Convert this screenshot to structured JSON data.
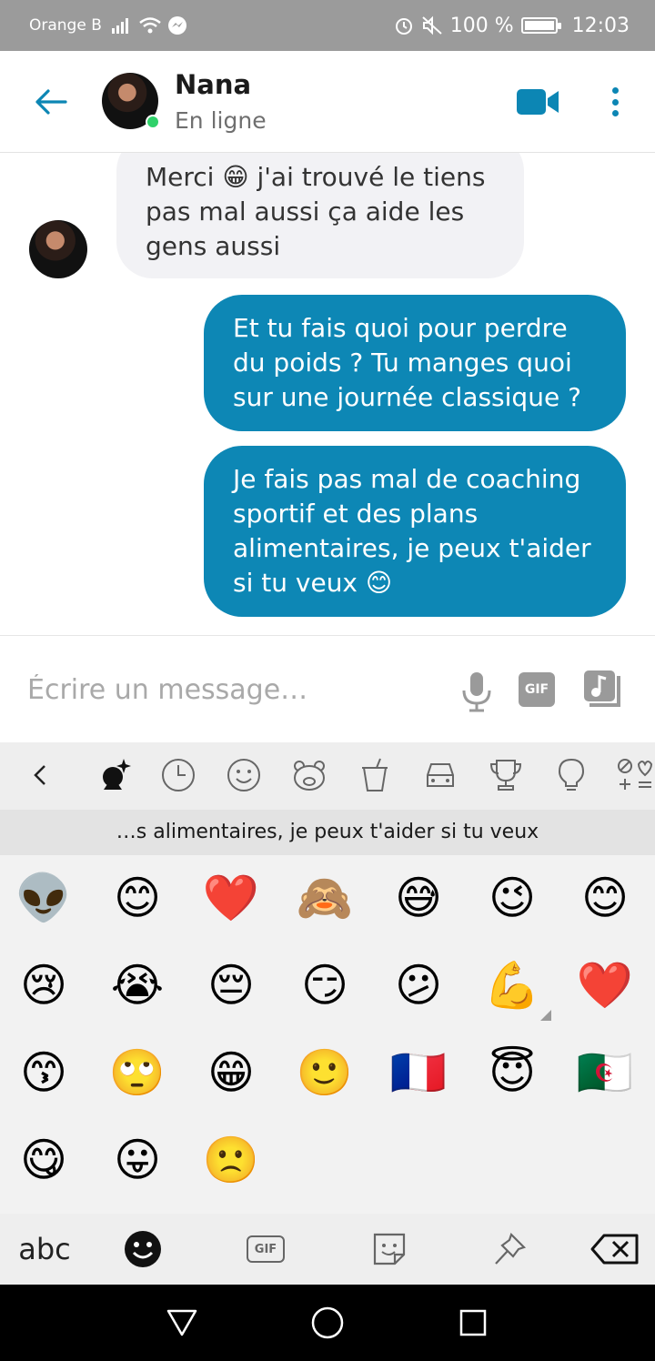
{
  "status_bar": {
    "carrier": "Orange B",
    "battery": "100 %",
    "time": "12:03"
  },
  "header": {
    "contact_name": "Nana",
    "contact_status": "En ligne"
  },
  "messages": [
    {
      "direction": "in",
      "text": "Merci 😁 j'ai trouvé le tiens pas mal aussi ça aide les gens aussi"
    },
    {
      "direction": "out",
      "text": "Et tu fais quoi pour perdre du poids ? Tu manges quoi sur une journée classique ?"
    },
    {
      "direction": "out",
      "text": "Je fais pas mal de coaching sportif et des plans alimentaires, je peux t'aider si tu veux 😊"
    }
  ],
  "composer": {
    "placeholder": "Écrire un message…",
    "gif_label": "GIF"
  },
  "keyboard": {
    "suggestion": "…s alimentaires, je peux t'aider si tu veux",
    "emojis": [
      [
        "👽",
        "😊",
        "❤️",
        "🙈",
        "😅",
        "😉",
        "😊"
      ],
      [
        "😢",
        "😭",
        "😔",
        "😏",
        "😕",
        "💪",
        "❤️"
      ],
      [
        "😙",
        "🙄",
        "😁",
        "🙂",
        "🇫🇷",
        "😇",
        "🇩🇿"
      ],
      [
        "😋",
        "😛",
        "🙁"
      ]
    ],
    "abc_label": "abc",
    "gif_label": "GIF"
  }
}
